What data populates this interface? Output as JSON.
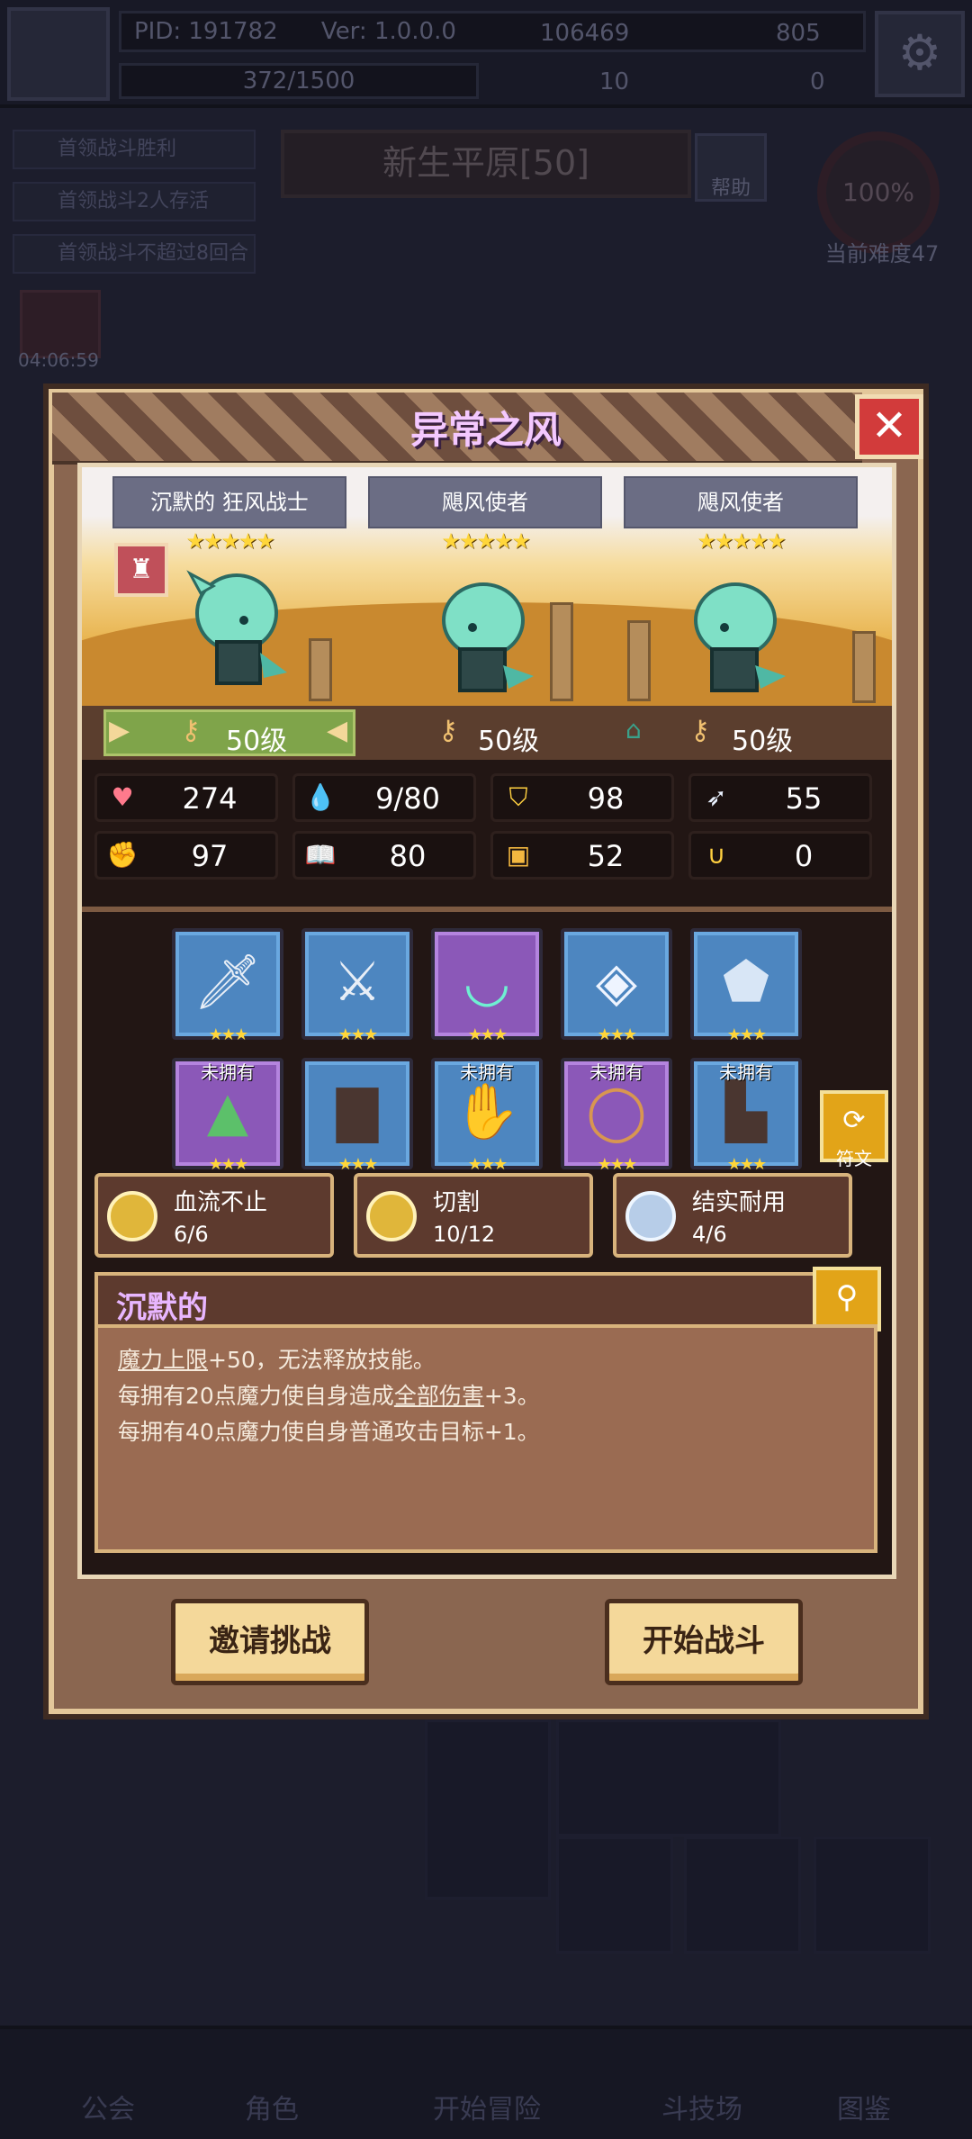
{
  "background": {
    "pid": "PID: 191782",
    "version": "Ver: 1.0.0.0",
    "xp": "372/1500",
    "gold": "106469",
    "gems": "805",
    "res3": "10",
    "res4": "0",
    "quests": [
      "首领战斗胜利",
      "首领战斗2人存活",
      "首领战斗不超过8回合"
    ],
    "map_title": "新生平原[50]",
    "help": "帮助",
    "difficulty_pct": "100%",
    "difficulty_label": "当前难度47",
    "timer": "04:06:59",
    "nav": [
      "公会",
      "角色",
      "开始冒险",
      "斗技场",
      "图鉴"
    ]
  },
  "modal": {
    "title": "异常之风",
    "close_icon": "close-icon",
    "enemies": [
      {
        "name": "沉默的 狂风战士",
        "stars": "★★★★★",
        "level": "50级"
      },
      {
        "name": "飓风使者",
        "stars": "★★★★★",
        "level": "50级"
      },
      {
        "name": "飓风使者",
        "stars": "★★★★★",
        "level": "50级"
      }
    ],
    "stats": [
      {
        "icon": "heart-icon",
        "value": "274"
      },
      {
        "icon": "mana-drop-icon",
        "value": "9/80"
      },
      {
        "icon": "shield-icon",
        "value": "98"
      },
      {
        "icon": "wing-icon",
        "value": "55"
      },
      {
        "icon": "fist-icon",
        "value": "97"
      },
      {
        "icon": "book-icon",
        "value": "80"
      },
      {
        "icon": "armor-icon",
        "value": "52"
      },
      {
        "icon": "horseshoe-icon",
        "value": "0"
      }
    ],
    "equipment": [
      {
        "icon": "sword-icon",
        "rarity": "blue",
        "stars": "★★★",
        "owned": ""
      },
      {
        "icon": "dagger-icon",
        "rarity": "blue",
        "stars": "★★★",
        "owned": ""
      },
      {
        "icon": "necklace-icon",
        "rarity": "purple",
        "stars": "★★★",
        "owned": ""
      },
      {
        "icon": "orb-icon",
        "rarity": "blue",
        "stars": "★★★",
        "owned": ""
      },
      {
        "icon": "crystal-icon",
        "rarity": "blue",
        "stars": "★★★",
        "owned": ""
      },
      {
        "icon": "hood-icon",
        "rarity": "purple",
        "stars": "★★★",
        "owned": "未拥有"
      },
      {
        "icon": "robe-icon",
        "rarity": "blue",
        "stars": "★★★",
        "owned": ""
      },
      {
        "icon": "gauntlet-icon",
        "rarity": "blue",
        "stars": "★★★",
        "owned": "未拥有"
      },
      {
        "icon": "belt-icon",
        "rarity": "purple",
        "stars": "★★★",
        "owned": "未拥有"
      },
      {
        "icon": "boots-icon",
        "rarity": "blue",
        "stars": "★★★",
        "owned": "未拥有"
      }
    ],
    "rune_label": "符文",
    "traits": [
      {
        "name": "血流不止",
        "count": "6/6",
        "coin": "gold"
      },
      {
        "name": "切割",
        "count": "10/12",
        "coin": "gold"
      },
      {
        "name": "结实耐用",
        "count": "4/6",
        "coin": "silver"
      }
    ],
    "affix": {
      "title": "沉默的",
      "detail_label": "详情",
      "line1_link": "魔力上限",
      "line1_rest": "+50，无法释放技能。",
      "line2_pre": "每拥有20点魔力使自身造成",
      "line2_link": "全部伤害",
      "line2_post": "+3。",
      "line3": "每拥有40点魔力使自身普通攻击目标+1。"
    },
    "buttons": {
      "invite": "邀请挑战",
      "start": "开始战斗"
    }
  }
}
